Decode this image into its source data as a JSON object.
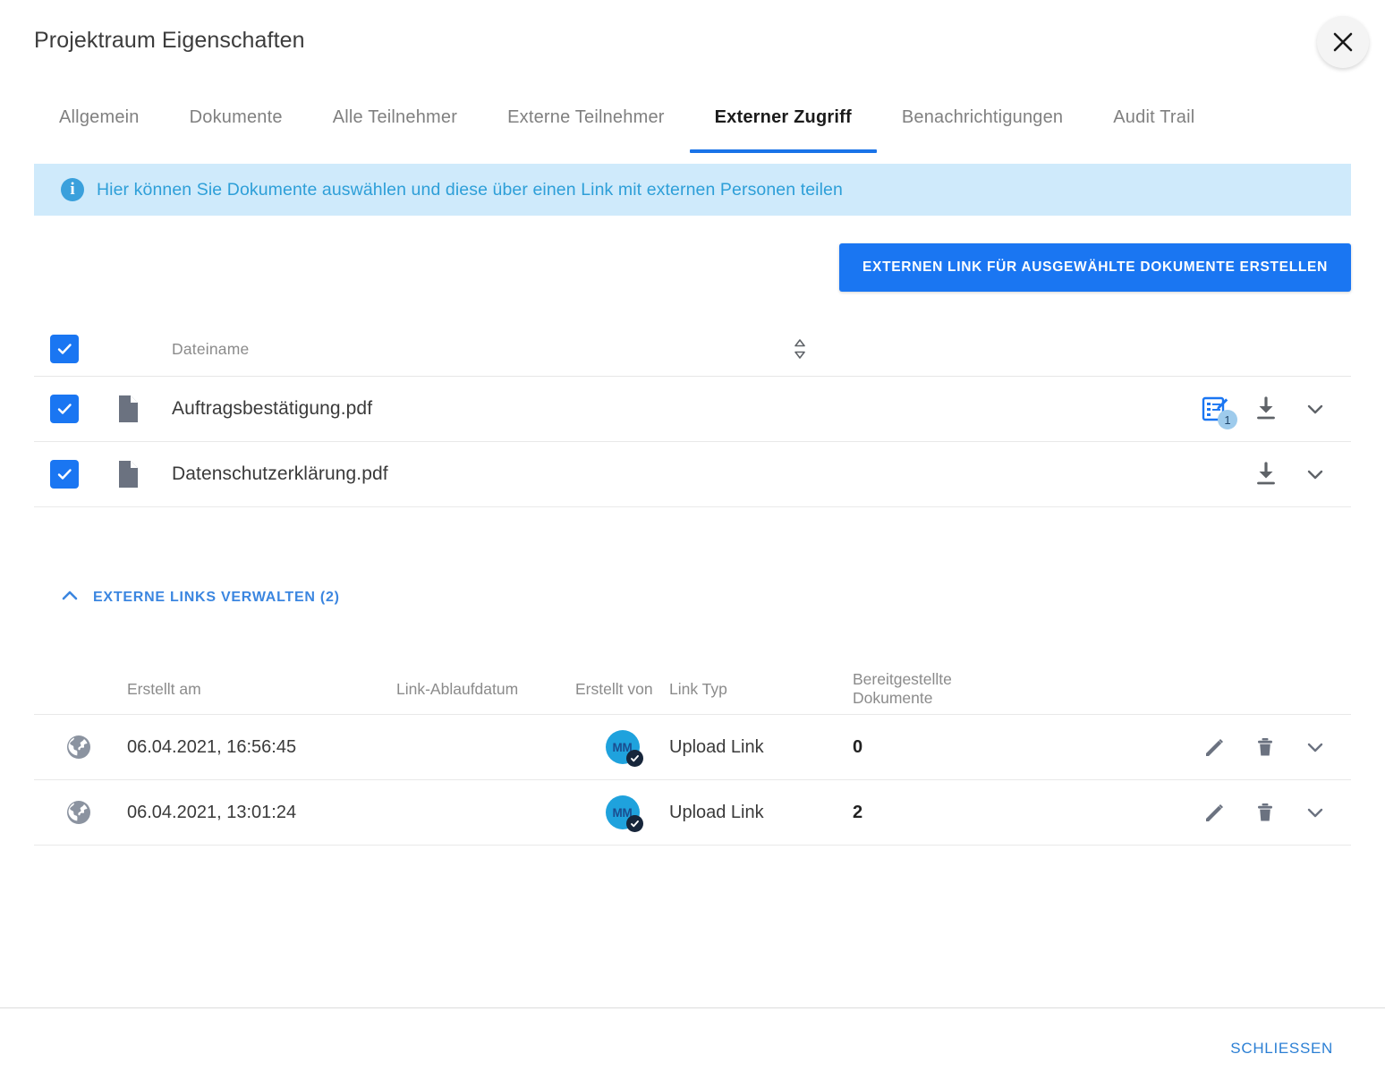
{
  "dialog": {
    "title": "Projektraum Eigenschaften",
    "close_icon": "close-icon"
  },
  "tabs": [
    {
      "label": "Allgemein",
      "active": false
    },
    {
      "label": "Dokumente",
      "active": false
    },
    {
      "label": "Alle Teilnehmer",
      "active": false
    },
    {
      "label": "Externe Teilnehmer",
      "active": false
    },
    {
      "label": "Externer Zugriff",
      "active": true
    },
    {
      "label": "Benachrichtigungen",
      "active": false
    },
    {
      "label": "Audit Trail",
      "active": false
    }
  ],
  "info_banner": {
    "icon": "info-icon",
    "text": "Hier können Sie Dokumente auswählen und diese über einen Link mit externen Personen teilen"
  },
  "actions": {
    "create_link_label": "EXTERNEN LINK FÜR AUSGEWÄHLTE DOKUMENTE ERSTELLEN"
  },
  "documents_table": {
    "header": {
      "select_all_checked": true,
      "filename_label": "Dateiname",
      "sort_icon": "sort-updown-icon"
    },
    "rows": [
      {
        "checked": true,
        "file_icon": "document-icon",
        "name": "Auftragsbestätigung.pdf",
        "form_badge": "1",
        "has_form_icon": true,
        "actions": [
          "form-edit-icon",
          "download-icon",
          "chevron-down-icon"
        ]
      },
      {
        "checked": true,
        "file_icon": "document-icon",
        "name": "Datenschutzerklärung.pdf",
        "form_badge": "",
        "has_form_icon": false,
        "actions": [
          "download-icon",
          "chevron-down-icon"
        ]
      }
    ]
  },
  "external_links": {
    "toggle_label": "EXTERNE LINKS VERWALTEN (2)",
    "toggle_icon": "chevron-up-icon",
    "expanded": true,
    "columns": {
      "created_at": "Erstellt am",
      "expiry": "Link-Ablaufdatum",
      "created_by": "Erstellt von",
      "link_type": "Link Typ",
      "provided_docs": "Bereitgestellte Dokumente"
    },
    "rows": [
      {
        "globe_icon": "globe-icon",
        "created_at": "06.04.2021, 16:56:45",
        "expiry": "",
        "avatar_initials": "MM",
        "avatar_verified": true,
        "link_type": "Upload Link",
        "provided_docs": "0",
        "actions": [
          "edit-pencil-icon",
          "trash-icon",
          "chevron-down-icon"
        ]
      },
      {
        "globe_icon": "globe-icon",
        "created_at": "06.04.2021, 13:01:24",
        "expiry": "",
        "avatar_initials": "MM",
        "avatar_verified": true,
        "link_type": "Upload Link",
        "provided_docs": "2",
        "actions": [
          "edit-pencil-icon",
          "trash-icon",
          "chevron-down-icon"
        ]
      }
    ]
  },
  "footer": {
    "close_label": "SCHLIESSEN"
  },
  "colors": {
    "accent_blue": "#1a76f2",
    "tab_underline": "#1a73e8",
    "info_bg": "#cfeafb",
    "info_text": "#2e9fd8",
    "link_blue": "#3b86e0",
    "avatar_bg": "#1fa2dd"
  }
}
